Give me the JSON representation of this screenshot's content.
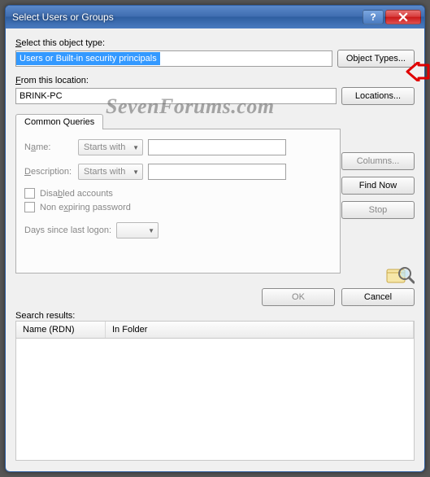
{
  "title": "Select Users or Groups",
  "labels": {
    "objectType": "Select this object type:",
    "fromLocation": "From this location:",
    "objectTypesBtn": "Object Types...",
    "locationsBtn": "Locations...",
    "columnsBtn": "Columns...",
    "findNowBtn": "Find Now",
    "stopBtn": "Stop",
    "okBtn": "OK",
    "cancelBtn": "Cancel",
    "searchResults": "Search results:",
    "colName": "Name (RDN)",
    "colFolder": "In Folder"
  },
  "values": {
    "objectType": "Users or Built-in security principals",
    "location": "BRINK-PC"
  },
  "queries": {
    "tab": "Common Queries",
    "nameLabel": "Name:",
    "descLabel": "Description:",
    "startsWith": "Starts with",
    "disabled": "Disabled accounts",
    "nonExpiring": "Non expiring password",
    "daysLogon": "Days since last logon:"
  },
  "watermark": "SevenForums.com"
}
